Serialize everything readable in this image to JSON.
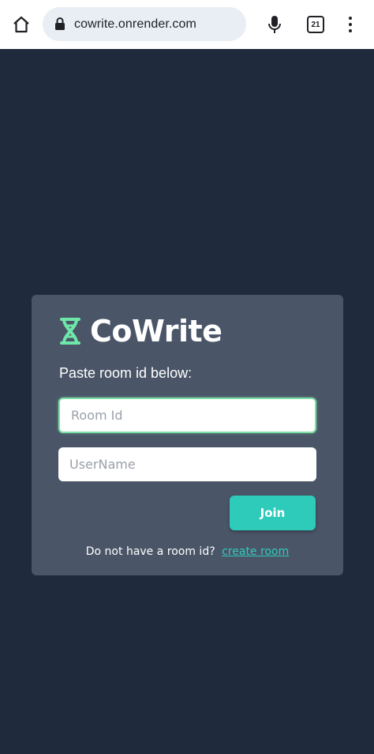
{
  "browser": {
    "url": "cowrite.onrender.com",
    "tab_count": "21"
  },
  "app": {
    "name": "CoWrite",
    "prompt": "Paste room id below:",
    "room_id_placeholder": "Room Id",
    "username_placeholder": "UserName",
    "join_label": "Join",
    "no_room_text": "Do not have a room id?",
    "create_room_link": "create room",
    "accent_color": "#2ecbbb",
    "logo_color": "#6ee7a8"
  }
}
